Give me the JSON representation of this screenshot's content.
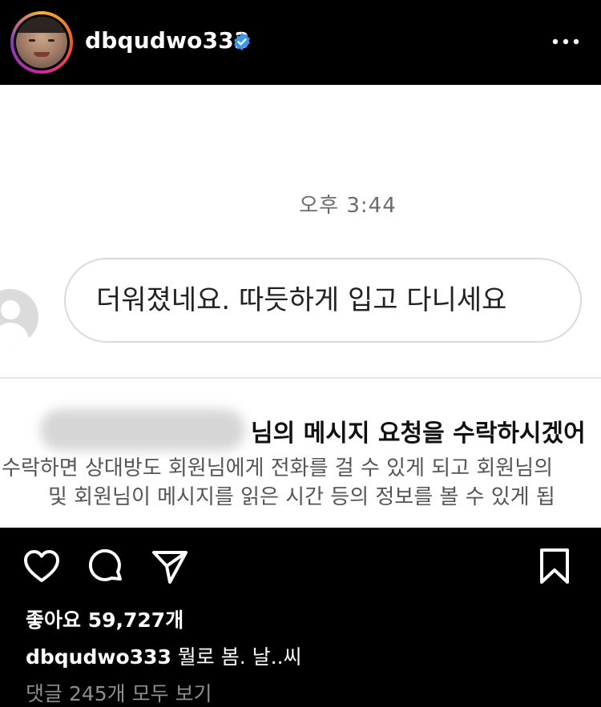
{
  "header": {
    "username": "dbqudwo333",
    "verified": true,
    "more_icon": "more-horizontal-icon"
  },
  "post_image": {
    "dm_time": "오후 3:44",
    "message": "더워졌네요. 따듯하게 입고 다니세요",
    "request_title": "님의 메시지 요청을 수락하시겠어",
    "request_line1": "수락하면 상대방도 회원님에게 전화를 걸 수 있게 되고 회원님의",
    "request_line2": "및 회원님이 메시지를 읽은 시간 등의 정보를 볼 수 있게 됩"
  },
  "actions": {
    "icons": [
      "heart-icon",
      "comment-icon",
      "share-icon",
      "bookmark-icon"
    ],
    "likes_label": "좋아요",
    "likes_count": "59,727개"
  },
  "caption": {
    "username": "dbqudwo333",
    "text": "뭘로 봄. 날..씨"
  },
  "comments_link": "댓글 245개 모두 보기",
  "colors": {
    "background": "#000000",
    "verified_blue": "#3897f0",
    "muted_text": "#8e8e8e"
  }
}
